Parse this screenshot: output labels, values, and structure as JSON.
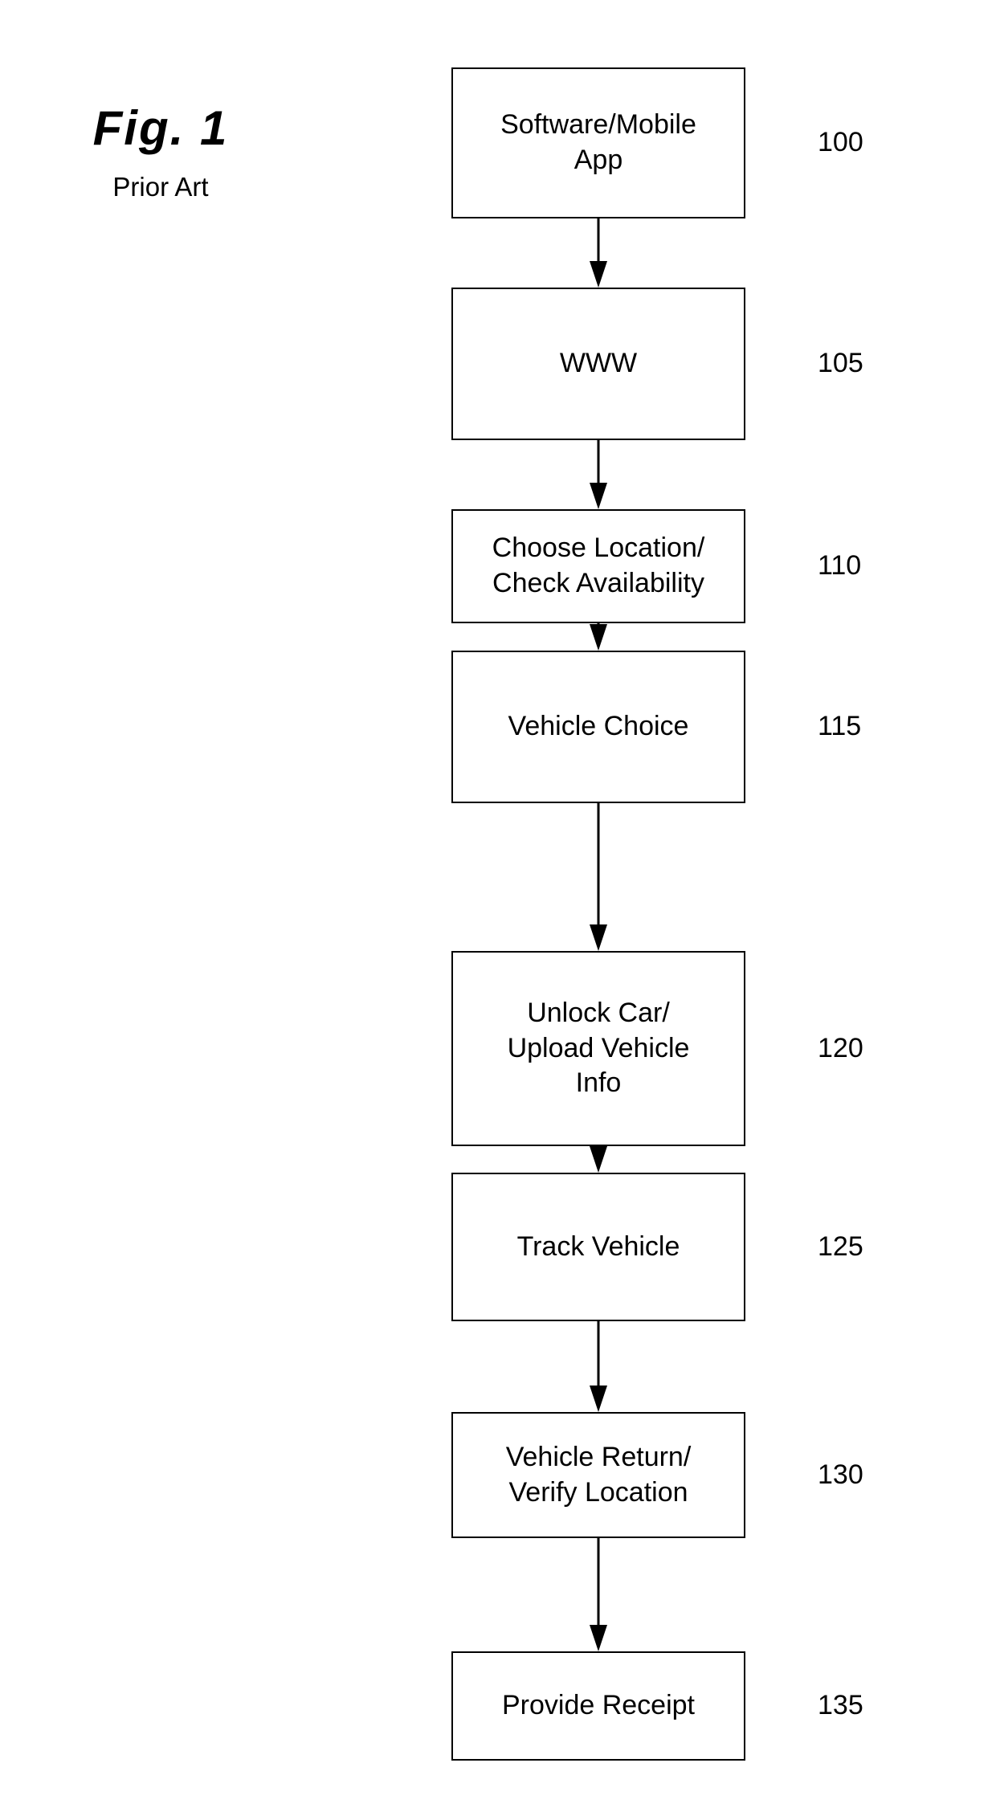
{
  "figure": {
    "title": "Fig. 1",
    "subtitle": "Prior Art"
  },
  "flowchart": {
    "orientation": "vertical",
    "arrow_style": "solid-filled-triangle",
    "line_color": "#000000",
    "box_fill": "#ffffff",
    "nodes": [
      {
        "label": "Software/Mobile\nApp",
        "ref": "100"
      },
      {
        "label": "WWW",
        "ref": "105"
      },
      {
        "label": "Choose Location/\nCheck Availability",
        "ref": "110"
      },
      {
        "label": "Vehicle Choice",
        "ref": "115"
      },
      {
        "label": "Unlock Car/\nUpload Vehicle\nInfo",
        "ref": "120"
      },
      {
        "label": "Track Vehicle",
        "ref": "125"
      },
      {
        "label": "Vehicle Return/\nVerify Location",
        "ref": "130"
      },
      {
        "label": "Provide Receipt",
        "ref": "135"
      }
    ]
  }
}
